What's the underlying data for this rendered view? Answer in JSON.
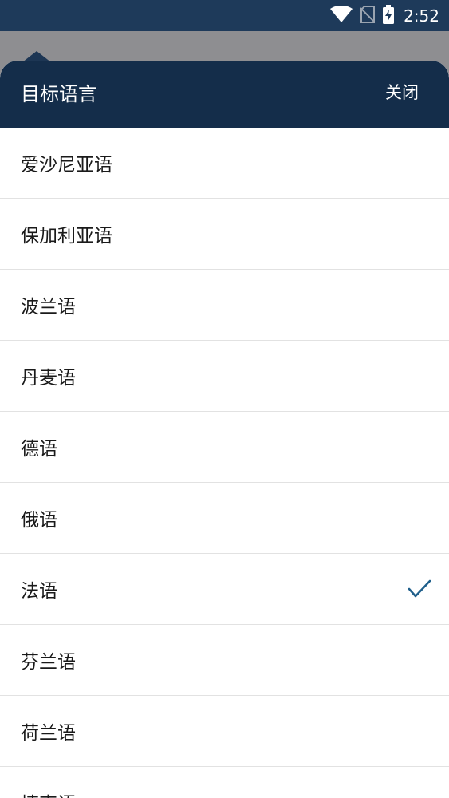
{
  "status_bar": {
    "time": "2:52",
    "icons": [
      "wifi-icon",
      "no-sim-icon",
      "battery-charging-icon"
    ]
  },
  "sheet": {
    "title": "目标语言",
    "close_label": "关闭"
  },
  "languages": [
    {
      "label": "爱沙尼亚语",
      "selected": false
    },
    {
      "label": "保加利亚语",
      "selected": false
    },
    {
      "label": "波兰语",
      "selected": false
    },
    {
      "label": "丹麦语",
      "selected": false
    },
    {
      "label": "德语",
      "selected": false
    },
    {
      "label": "俄语",
      "selected": false
    },
    {
      "label": "法语",
      "selected": true
    },
    {
      "label": "芬兰语",
      "selected": false
    },
    {
      "label": "荷兰语",
      "selected": false
    },
    {
      "label": "捷克语",
      "selected": false
    }
  ],
  "colors": {
    "status_bar": "#1e3a5a",
    "header": "#142d4a",
    "check": "#1f5f8b",
    "backdrop": "#8e8e91"
  }
}
